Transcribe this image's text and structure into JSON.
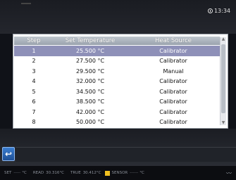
{
  "header": {
    "time": "13:34"
  },
  "table": {
    "columns": [
      "Step",
      "Set Temperature",
      "Heat Source"
    ],
    "rows": [
      {
        "step": "1",
        "temp": "25.500 °C",
        "source": "Calibrator"
      },
      {
        "step": "2",
        "temp": "27.500 °C",
        "source": "Calibrator"
      },
      {
        "step": "3",
        "temp": "29.500 °C",
        "source": "Manual"
      },
      {
        "step": "4",
        "temp": "32.000 °C",
        "source": "Calibrator"
      },
      {
        "step": "5",
        "temp": "34.500 °C",
        "source": "Calibrator"
      },
      {
        "step": "6",
        "temp": "38.500 °C",
        "source": "Calibrator"
      },
      {
        "step": "7",
        "temp": "42.000 °C",
        "source": "Calibrator"
      },
      {
        "step": "8",
        "temp": "50.000 °C",
        "source": "Calibrator"
      }
    ]
  },
  "statusbar": {
    "set_label": "SET",
    "set_value": "-----",
    "set_unit": "°C",
    "read_label": "READ",
    "read_value": "30.316°C",
    "true_label": "TRUE",
    "true_value": "30.412°C",
    "sensor_label": "SENSOR",
    "sensor_value": "------",
    "sensor_unit": "°C"
  },
  "colors": {
    "selected_row": "#8e90b8",
    "back_button": "#2a66b5",
    "sensor_indicator": "#f0c020"
  },
  "icons": {
    "clock": "clock-icon",
    "back": "back-arrow-icon",
    "signal": "signal-icon"
  }
}
